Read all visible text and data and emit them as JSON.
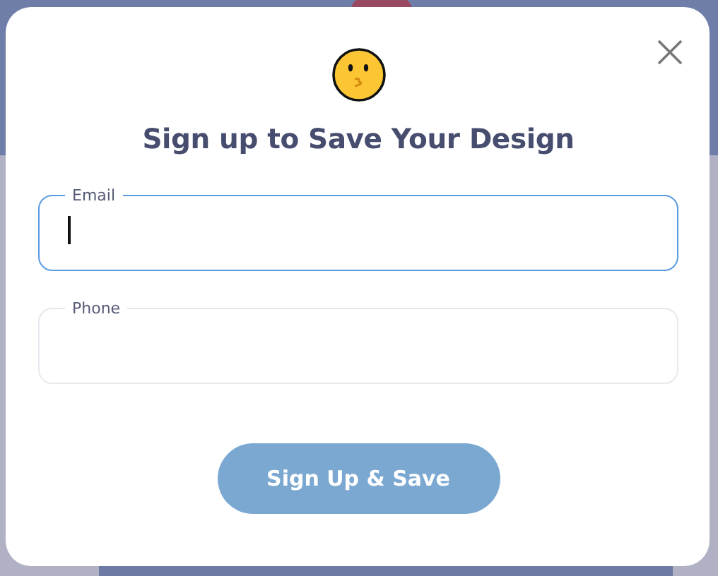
{
  "dialog": {
    "title": "Sign up to Save Your Design",
    "fields": [
      {
        "label": "Email",
        "focused": true
      },
      {
        "label": "Phone",
        "focused": false
      }
    ],
    "submit_button": {
      "label": "Sign Up & Save",
      "disabled": true
    }
  }
}
